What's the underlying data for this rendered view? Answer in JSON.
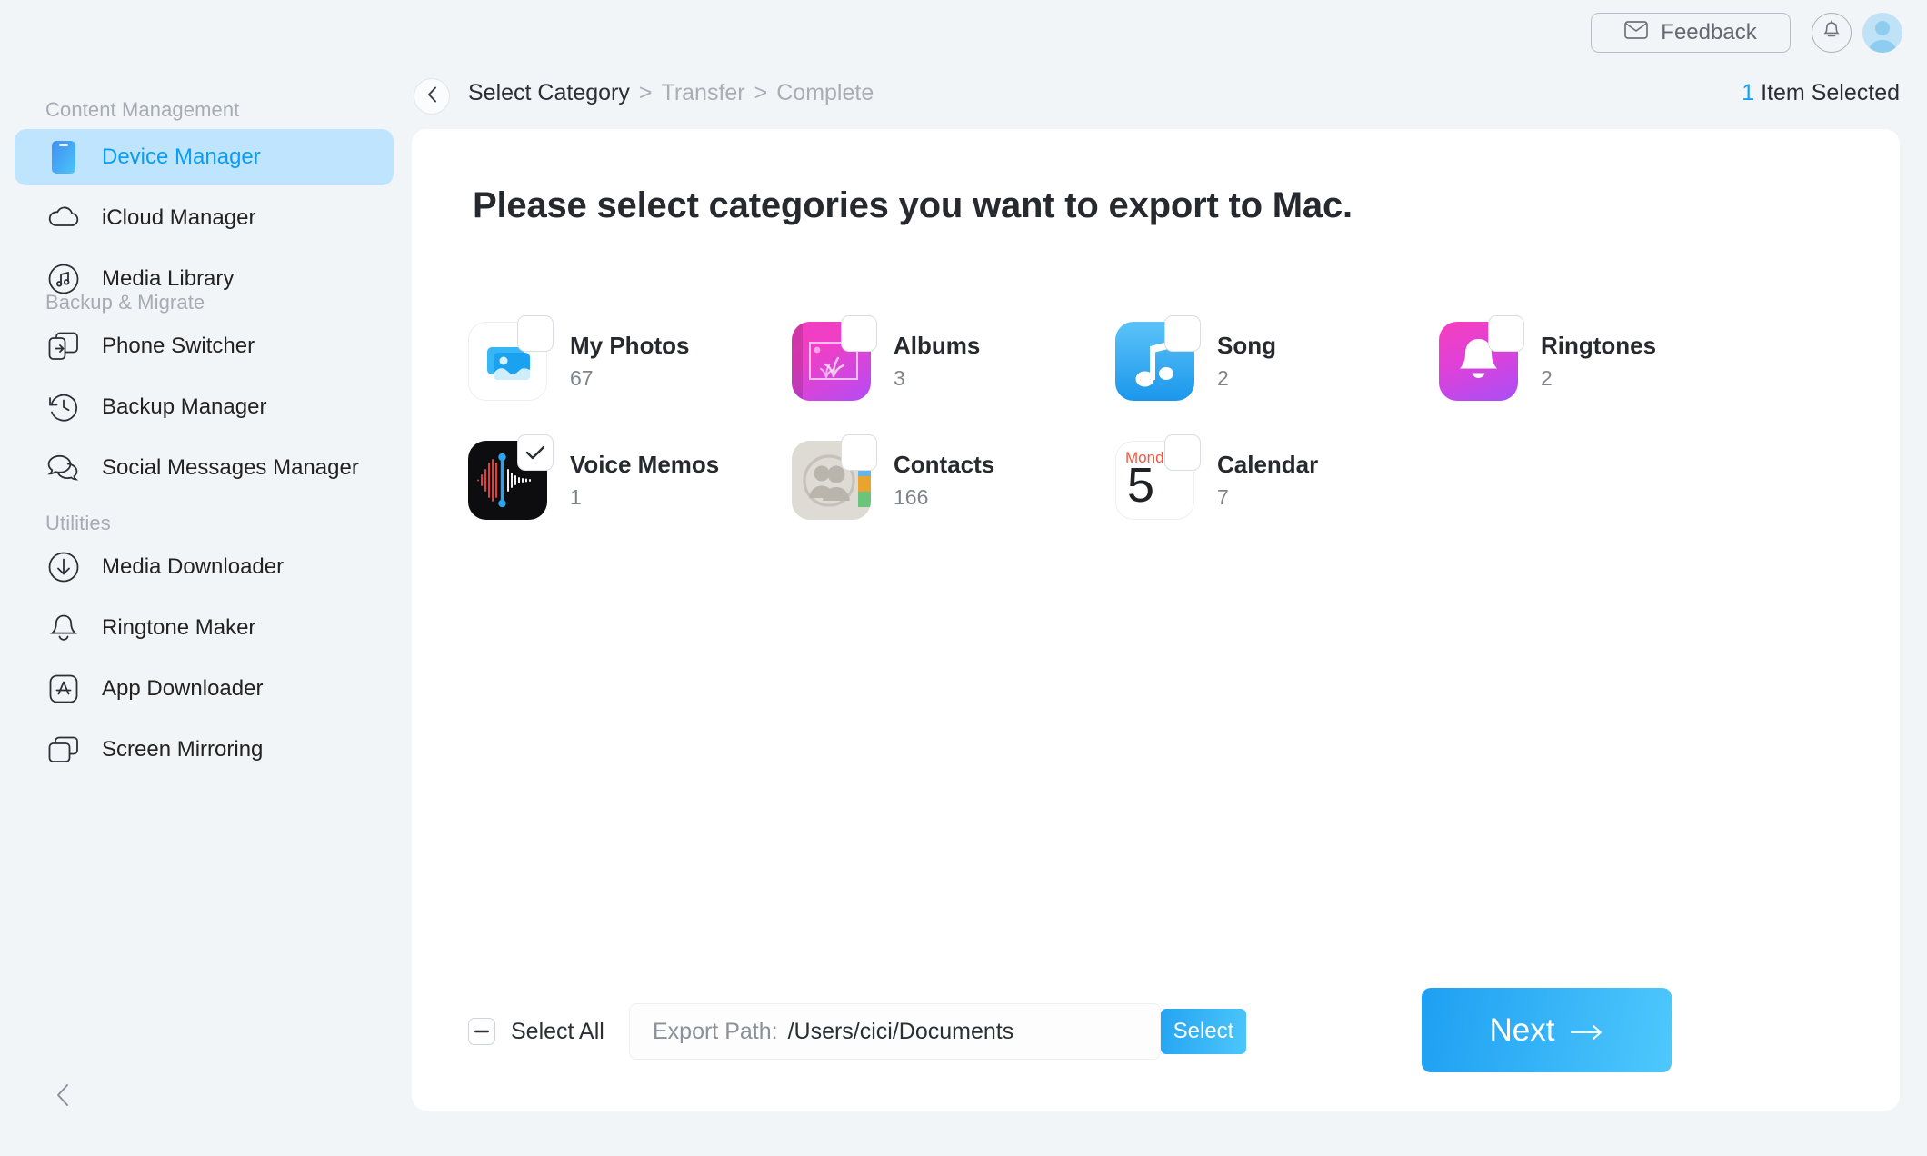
{
  "window": {
    "traffic_lights": [
      {
        "name": "close",
        "color": "#ff5f57"
      },
      {
        "name": "minimize",
        "color": "#febc2e"
      },
      {
        "name": "maximize",
        "color": "#28c840"
      }
    ]
  },
  "topbar": {
    "feedback_label": "Feedback",
    "feedback_icon": "mail-icon",
    "bell_icon": "notification-bell-icon",
    "avatar_icon": "user-avatar-icon"
  },
  "breadcrumb": {
    "back_icon": "chevron-left-icon",
    "steps": [
      {
        "label": "Select Category",
        "state": "current"
      },
      {
        "label": "Transfer",
        "state": "upcoming"
      },
      {
        "label": "Complete",
        "state": "upcoming"
      }
    ],
    "separator": ">"
  },
  "selection": {
    "count": "1",
    "label": "Item Selected"
  },
  "sidebar": {
    "sections": [
      {
        "title": "Content Management",
        "items": [
          {
            "label": "Device Manager",
            "icon": "device-phone-icon",
            "active": true
          },
          {
            "label": "iCloud Manager",
            "icon": "cloud-icon",
            "active": false
          },
          {
            "label": "Media Library",
            "icon": "music-note-circle-icon",
            "active": false
          }
        ]
      },
      {
        "title": "Backup & Migrate",
        "items": [
          {
            "label": "Phone Switcher",
            "icon": "phone-switch-icon",
            "active": false
          },
          {
            "label": "Backup Manager",
            "icon": "clock-restore-icon",
            "active": false
          },
          {
            "label": "Social Messages Manager",
            "icon": "chat-bubbles-icon",
            "active": false
          }
        ]
      },
      {
        "title": "Utilities",
        "items": [
          {
            "label": "Media Downloader",
            "icon": "download-circle-icon",
            "active": false
          },
          {
            "label": "Ringtone Maker",
            "icon": "bell-icon",
            "active": false
          },
          {
            "label": "App Downloader",
            "icon": "app-store-icon",
            "active": false
          },
          {
            "label": "Screen Mirroring",
            "icon": "screens-icon",
            "active": false
          }
        ]
      }
    ],
    "collapse_icon": "chevron-left-icon"
  },
  "main": {
    "title": "Please select categories you want to export to Mac.",
    "categories": [
      {
        "name": "My Photos",
        "count": "67",
        "icon": "photos-app-icon",
        "checked": false
      },
      {
        "name": "Albums",
        "count": "3",
        "icon": "albums-app-icon",
        "checked": false
      },
      {
        "name": "Song",
        "count": "2",
        "icon": "music-app-icon",
        "checked": false
      },
      {
        "name": "Ringtones",
        "count": "2",
        "icon": "ringtones-icon",
        "checked": false
      },
      {
        "name": "Voice Memos",
        "count": "1",
        "icon": "voice-memos-icon",
        "checked": true
      },
      {
        "name": "Contacts",
        "count": "166",
        "icon": "contacts-app-icon",
        "checked": false
      },
      {
        "name": "Calendar",
        "count": "7",
        "icon": "calendar-app-icon",
        "checked": false
      }
    ],
    "calendar_icon_text": {
      "weekday": "Monday",
      "day": "5"
    }
  },
  "footer": {
    "select_all_label": "Select All",
    "select_all_state": "indeterminate",
    "export_path_label": "Export Path:",
    "export_path_value": "/Users/cici/Documents",
    "export_path_placeholder": "/Users/cici/Documents",
    "select_button_label": "Select",
    "next_button_label": "Next",
    "next_button_icon": "arrow-right-icon"
  },
  "colors": {
    "accent": "#14a0f3",
    "sidebar_active_bg": "#bfe4fd",
    "sidebar_active_text": "#0a9df5",
    "page_bg": "#f2f5f7",
    "card_bg": "#ffffff"
  }
}
